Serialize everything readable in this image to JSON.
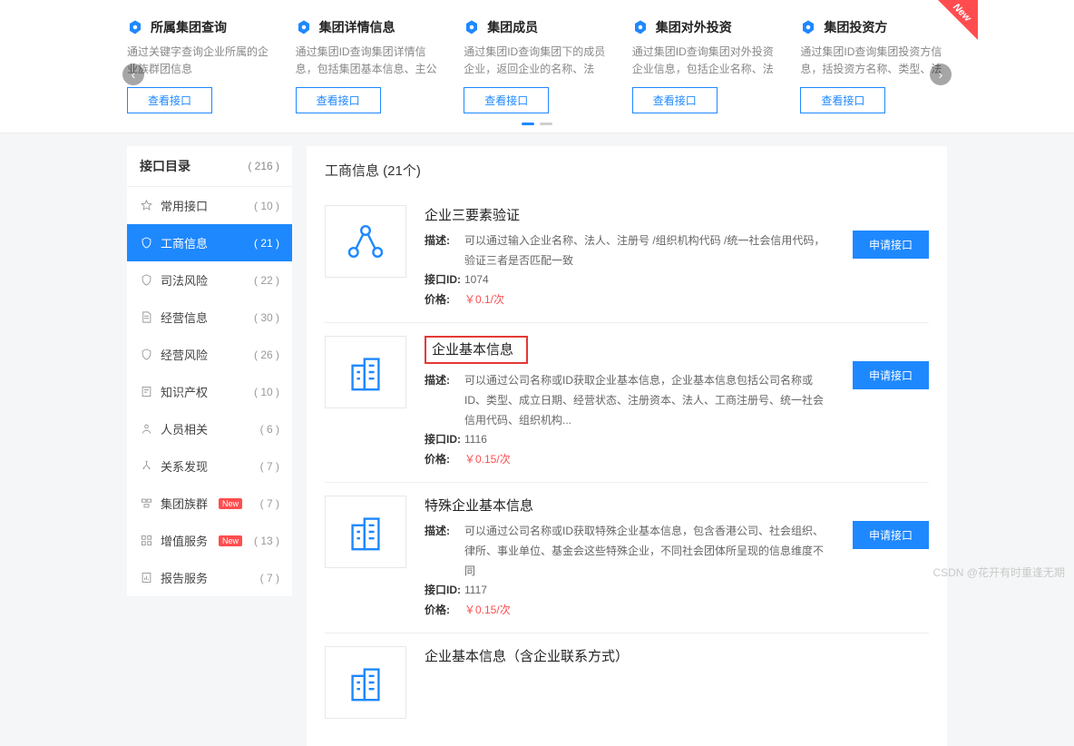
{
  "carousel": {
    "viewBtnLabel": "查看接口",
    "newBadge": "New",
    "cards": [
      {
        "title": "所属集团查询",
        "desc": "通过关键字查询企业所属的企业族群团信息"
      },
      {
        "title": "集团详情信息",
        "desc": "通过集团ID查询集团详情信息，包括集团基本信息、主公司、疑似实际..."
      },
      {
        "title": "集团成员",
        "desc": "通过集团ID查询集团下的成员企业，返回企业的名称、法人、注册资本..."
      },
      {
        "title": "集团对外投资",
        "desc": "通过集团ID查询集团对外投资企业信息，包括企业名称、法定代表人..."
      },
      {
        "title": "集团投资方",
        "desc": "通过集团ID查询集团投资方信息，括投资方名称、类型、法定代表人..."
      }
    ]
  },
  "sidebar": {
    "title": "接口目录",
    "totalCount": "( 216 )",
    "newBadge": "New",
    "items": [
      {
        "label": "常用接口",
        "count": "( 10 )",
        "icon": "star"
      },
      {
        "label": "工商信息",
        "count": "( 21 )",
        "icon": "shield",
        "active": true
      },
      {
        "label": "司法风险",
        "count": "( 22 )",
        "icon": "shield"
      },
      {
        "label": "经营信息",
        "count": "( 30 )",
        "icon": "file"
      },
      {
        "label": "经营风险",
        "count": "( 26 )",
        "icon": "shield"
      },
      {
        "label": "知识产权",
        "count": "( 10 )",
        "icon": "note"
      },
      {
        "label": "人员相关",
        "count": "( 6 )",
        "icon": "person"
      },
      {
        "label": "关系发现",
        "count": "( 7 )",
        "icon": "tree"
      },
      {
        "label": "集团族群",
        "count": "( 7 )",
        "icon": "group",
        "new": true
      },
      {
        "label": "增值服务",
        "count": "( 13 )",
        "icon": "grid",
        "new": true
      },
      {
        "label": "报告服务",
        "count": "( 7 )",
        "icon": "report"
      }
    ]
  },
  "section": {
    "title": "工商信息 (21个)",
    "labels": {
      "desc": "描述:",
      "id": "接口ID:",
      "price": "价格:"
    },
    "applyLabel": "申请接口",
    "items": [
      {
        "title": "企业三要素验证",
        "desc": "可以通过输入企业名称、法人、注册号 /组织机构代码 /统一社会信用代码，验证三者是否匹配一致",
        "id": "1074",
        "price": "￥0.1/次",
        "icon": "share",
        "highlight": false
      },
      {
        "title": "企业基本信息",
        "desc": "可以通过公司名称或ID获取企业基本信息，企业基本信息包括公司名称或ID、类型、成立日期、经营状态、注册资本、法人、工商注册号、统一社会信用代码、组织机构...",
        "id": "1116",
        "price": "￥0.15/次",
        "icon": "building",
        "highlight": true
      },
      {
        "title": "特殊企业基本信息",
        "desc": "可以通过公司名称或ID获取特殊企业基本信息，包含香港公司、社会组织、律所、事业单位、基金会这些特殊企业，不同社会团体所呈现的信息维度不同",
        "id": "1117",
        "price": "￥0.15/次",
        "icon": "building",
        "highlight": false
      },
      {
        "title": "企业基本信息（含企业联系方式）",
        "desc": "",
        "id": "",
        "price": "",
        "icon": "building",
        "highlight": false
      }
    ]
  },
  "watermark": "CSDN @花开有时重逢无期"
}
